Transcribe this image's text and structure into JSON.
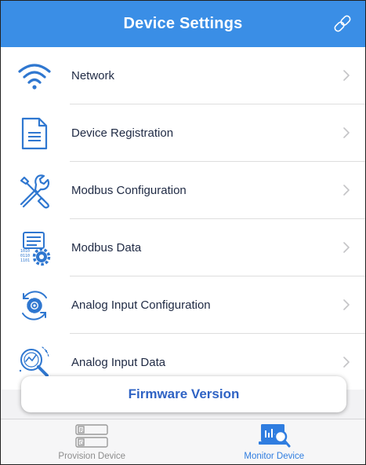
{
  "header": {
    "title": "Device Settings",
    "link_icon": "link-icon"
  },
  "menu": {
    "items": [
      {
        "label": "Network",
        "icon": "wifi-icon"
      },
      {
        "label": "Device Registration",
        "icon": "document-icon"
      },
      {
        "label": "Modbus Configuration",
        "icon": "tools-icon"
      },
      {
        "label": "Modbus Data",
        "icon": "binary-gear-icon"
      },
      {
        "label": "Analog Input Configuration",
        "icon": "gear-refresh-icon"
      },
      {
        "label": "Analog Input Data",
        "icon": "gauge-magnifier-icon"
      }
    ],
    "chevron_icon": "chevron-right-icon"
  },
  "firmware": {
    "label": "Firmware Version"
  },
  "tabbar": {
    "tabs": [
      {
        "label": "Provision Device",
        "icon": "provision-device-icon",
        "active": false,
        "icon_text_top": "R",
        "icon_text_bottom": "G"
      },
      {
        "label": "Monitor Device",
        "icon": "monitor-device-icon",
        "active": true
      }
    ]
  },
  "colors": {
    "accent": "#3a8ee6",
    "icon_blue": "#2f77d0",
    "active_tab": "#2f7de0",
    "inactive_tab": "#8c8c8c"
  }
}
